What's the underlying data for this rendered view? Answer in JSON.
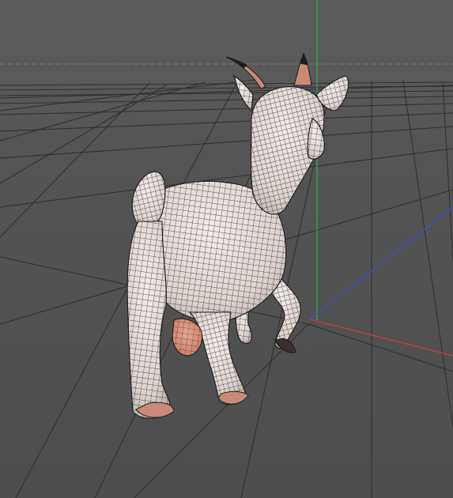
{
  "viewport": {
    "label": "",
    "mode": "perspective-3d",
    "background_color": "#555555",
    "grid_color": "#2e2e2e",
    "horizon_line": "dashed",
    "axes": {
      "x": {
        "color": "#d23a3a"
      },
      "y": {
        "color": "#2fa84f"
      },
      "z": {
        "color": "#3a4fd2"
      }
    }
  },
  "model": {
    "subject": "goat",
    "display": "wireframe-on-shaded",
    "surface_color": "#e8e0dc",
    "wire_color": "#1e1e1e",
    "accent_color": "#d9907a"
  }
}
